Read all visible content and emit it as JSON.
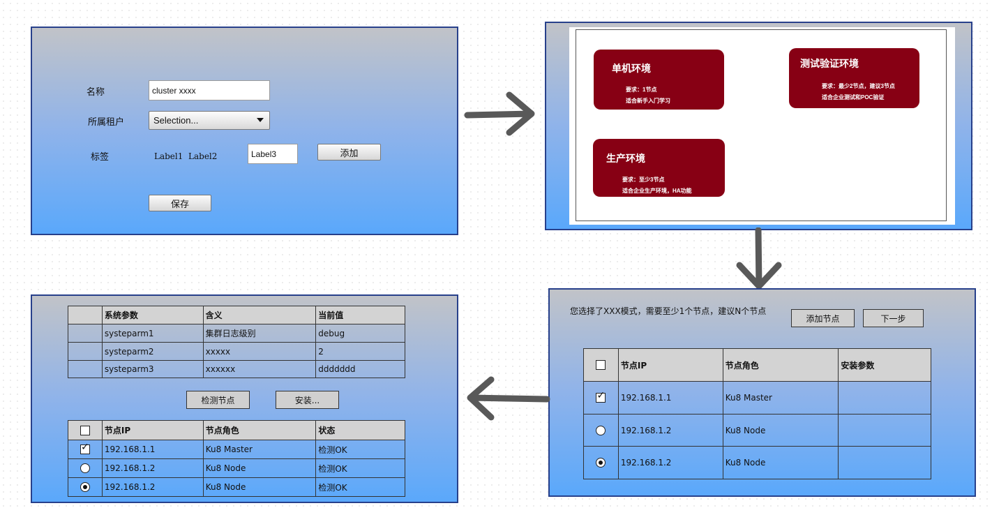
{
  "form_panel": {
    "name_label": "名称",
    "name_value": "cluster xxxx",
    "tenant_label": "所属租户",
    "tenant_selected": "Selection...",
    "tags_label": "标签",
    "tags": "Label1  Label2",
    "tag_input_value": "Label3",
    "add_button": "添加",
    "save_button": "保存"
  },
  "env_panel": {
    "cards": [
      {
        "title": "单机环境",
        "lines": [
          "要求：1节点",
          "适合新手入门学习"
        ]
      },
      {
        "title": "测试验证环境",
        "lines": [
          "要求：最少2节点，建议3节点",
          "适合企业测试和POC验证"
        ]
      },
      {
        "title": "生产环境",
        "lines": [
          "要求：至少3节点",
          "适合企业生产环境，HA功能"
        ]
      }
    ]
  },
  "node_panel": {
    "message": "您选择了XXX模式，需要至少1个节点，建议N个节点",
    "add_node_button": "添加节点",
    "next_button": "下一步",
    "headers": [
      "节点IP",
      "节点角色",
      "安装参数"
    ],
    "rows": [
      {
        "control": "checkbox-checked",
        "ip": "192.168.1.1",
        "role": "Ku8 Master",
        "params": ""
      },
      {
        "control": "radio",
        "ip": "192.168.1.2",
        "role": "Ku8 Node",
        "params": ""
      },
      {
        "control": "radio-selected",
        "ip": "192.168.1.2",
        "role": "Ku8 Node",
        "params": ""
      }
    ]
  },
  "install_panel": {
    "param_headers": [
      "系统参数",
      "含义",
      "当前值"
    ],
    "param_rows": [
      {
        "name": "systeparm1",
        "meaning": "集群日志级别",
        "value": "debug"
      },
      {
        "name": "systeparm2",
        "meaning": "xxxxx",
        "value": "2"
      },
      {
        "name": "systeparm3",
        "meaning": "xxxxxx",
        "value": "ddddddd"
      }
    ],
    "check_button": "检测节点",
    "install_button": "安装...",
    "node_headers": [
      "节点IP",
      "节点角色",
      "状态"
    ],
    "node_rows": [
      {
        "control": "checkbox-checked",
        "ip": "192.168.1.1",
        "role": "Ku8 Master",
        "status": "检测OK"
      },
      {
        "control": "radio",
        "ip": "192.168.1.2",
        "role": "Ku8 Node",
        "status": "检测OK"
      },
      {
        "control": "radio-selected",
        "ip": "192.168.1.2",
        "role": "Ku8 Node",
        "status": "检测OK"
      }
    ]
  }
}
